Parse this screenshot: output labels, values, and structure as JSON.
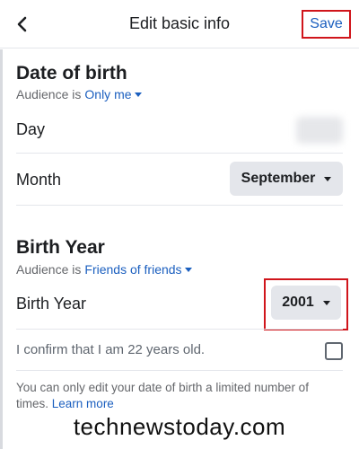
{
  "header": {
    "title": "Edit basic info",
    "save_label": "Save",
    "back_icon": "chevron-left-icon"
  },
  "date_of_birth": {
    "title": "Date of birth",
    "audience_prefix": "Audience is",
    "audience_value": "Only me",
    "day_label": "Day",
    "month_label": "Month",
    "month_value": "September"
  },
  "birth_year": {
    "title": "Birth Year",
    "audience_prefix": "Audience is",
    "audience_value": "Friends of friends",
    "row_label": "Birth Year",
    "year_value": "2001"
  },
  "confirm": {
    "text": "I confirm that I am 22 years old.",
    "checked": false
  },
  "info": {
    "text": "You can only edit your date of birth a limited number of times.",
    "link": "Learn more"
  },
  "watermark": "technewstoday.com",
  "colors": {
    "accent": "#1b5fbf",
    "highlight": "#d0151b",
    "pill_bg": "#e4e6eb"
  }
}
